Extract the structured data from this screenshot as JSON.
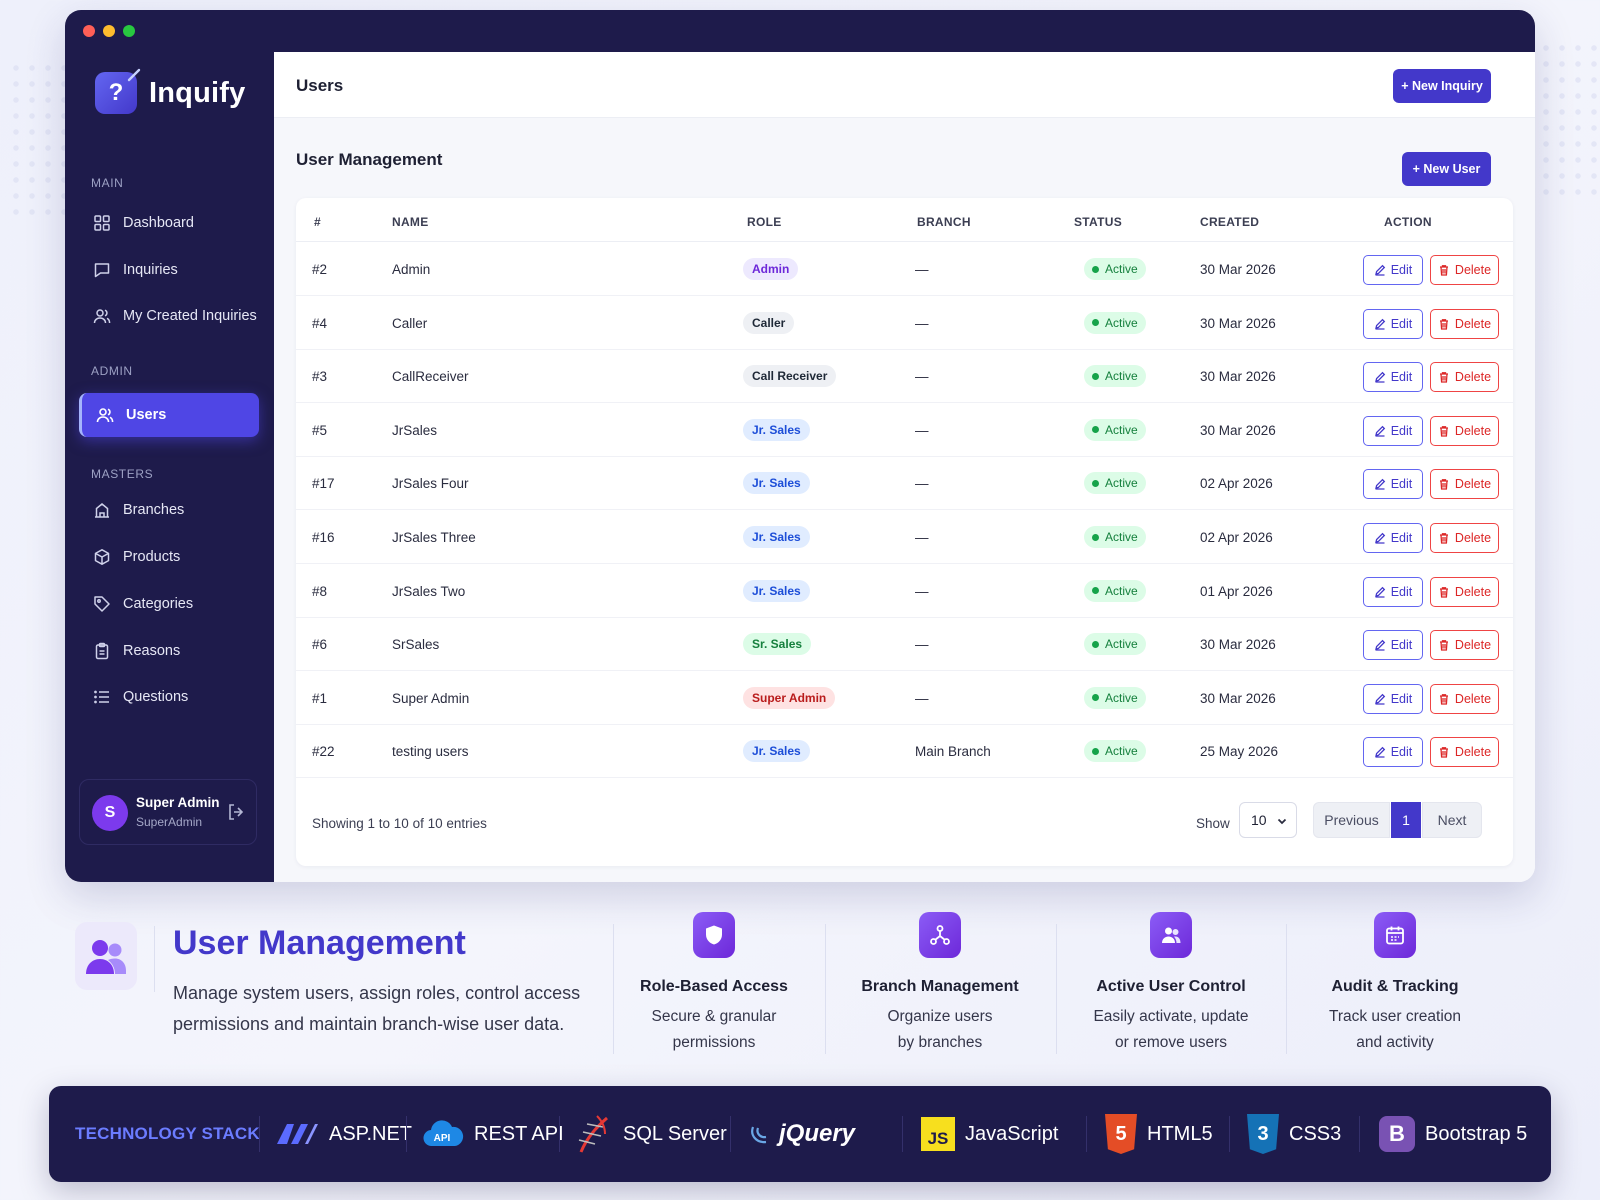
{
  "app": {
    "name": "Inquify"
  },
  "sidebar": {
    "sections": [
      {
        "label": "MAIN"
      },
      {
        "label": "ADMIN"
      },
      {
        "label": "MASTERS"
      }
    ],
    "items": [
      {
        "label": "Dashboard",
        "icon": "grid-icon"
      },
      {
        "label": "Inquiries",
        "icon": "chat-icon"
      },
      {
        "label": "My Created Inquiries",
        "icon": "users-icon"
      },
      {
        "label": "Users",
        "icon": "users-icon",
        "active": true
      },
      {
        "label": "Branches",
        "icon": "building-icon"
      },
      {
        "label": "Products",
        "icon": "box-icon"
      },
      {
        "label": "Categories",
        "icon": "tag-icon"
      },
      {
        "label": "Reasons",
        "icon": "clipboard-icon"
      },
      {
        "label": "Questions",
        "icon": "list-icon"
      }
    ],
    "user": {
      "initial": "S",
      "name": "Super Admin",
      "role": "SuperAdmin"
    }
  },
  "header": {
    "title": "Users",
    "new_inquiry": "+ New Inquiry"
  },
  "main": {
    "title": "User Management",
    "new_user": "+ New User",
    "columns": [
      "#",
      "NAME",
      "ROLE",
      "BRANCH",
      "STATUS",
      "CREATED",
      "ACTION"
    ],
    "rows": [
      {
        "id": "#2",
        "name": "Admin",
        "role": "Admin",
        "branch": "—",
        "status": "Active",
        "created": "30 Mar 2026"
      },
      {
        "id": "#4",
        "name": "Caller",
        "role": "Caller",
        "branch": "—",
        "status": "Active",
        "created": "30 Mar 2026"
      },
      {
        "id": "#3",
        "name": "CallReceiver",
        "role": "Call Receiver",
        "branch": "—",
        "status": "Active",
        "created": "30 Mar 2026"
      },
      {
        "id": "#5",
        "name": "JrSales",
        "role": "Jr. Sales",
        "branch": "—",
        "status": "Active",
        "created": "30 Mar 2026"
      },
      {
        "id": "#17",
        "name": "JrSales Four",
        "role": "Jr. Sales",
        "branch": "—",
        "status": "Active",
        "created": "02 Apr 2026"
      },
      {
        "id": "#16",
        "name": "JrSales Three",
        "role": "Jr. Sales",
        "branch": "—",
        "status": "Active",
        "created": "02 Apr 2026"
      },
      {
        "id": "#8",
        "name": "JrSales Two",
        "role": "Jr. Sales",
        "branch": "—",
        "status": "Active",
        "created": "01 Apr 2026"
      },
      {
        "id": "#6",
        "name": "SrSales",
        "role": "Sr. Sales",
        "branch": "—",
        "status": "Active",
        "created": "30 Mar 2026"
      },
      {
        "id": "#1",
        "name": "Super Admin",
        "role": "Super Admin",
        "branch": "—",
        "status": "Active",
        "created": "30 Mar 2026"
      },
      {
        "id": "#22",
        "name": "testing users",
        "role": "Jr. Sales",
        "branch": "Main Branch",
        "status": "Active",
        "created": "25 May 2026"
      }
    ],
    "actions": {
      "edit": "Edit",
      "delete": "Delete"
    },
    "footer": {
      "showing": "Showing 1 to 10 of 10 entries",
      "show_label": "Show",
      "page_size": "10",
      "previous": "Previous",
      "page": "1",
      "next": "Next"
    }
  },
  "feature": {
    "title": "User Management",
    "line1": "Manage system users, assign roles, control access",
    "line2": "permissions and maintain branch-wise user data.",
    "cards": [
      {
        "title": "Role-Based Access",
        "line1": "Secure & granular",
        "line2": "permissions",
        "icon": "shield-icon"
      },
      {
        "title": "Branch Management",
        "line1": "Organize users",
        "line2": "by branches",
        "icon": "network-icon"
      },
      {
        "title": "Active User Control",
        "line1": "Easily activate, update",
        "line2": "or remove users",
        "icon": "users-icon"
      },
      {
        "title": "Audit & Tracking",
        "line1": "Track user creation",
        "line2": "and activity",
        "icon": "calendar-icon"
      }
    ]
  },
  "tech": {
    "label": "TECHNOLOGY STACK",
    "items": [
      {
        "name": "ASP.NET"
      },
      {
        "name": "REST API",
        "badge": "API"
      },
      {
        "name": "SQL Server"
      },
      {
        "name": "jQuery"
      },
      {
        "name": "JavaScript",
        "badge": "JS"
      },
      {
        "name": "HTML5",
        "badge": "5"
      },
      {
        "name": "CSS3",
        "badge": "3"
      },
      {
        "name": "Bootstrap 5",
        "badge": "B"
      }
    ]
  },
  "colors": {
    "sidebar": "#1e1b4b",
    "accent": "#4338ca",
    "active_nav": "#4f46e5",
    "success": "#16a34a",
    "danger": "#dc2626"
  }
}
